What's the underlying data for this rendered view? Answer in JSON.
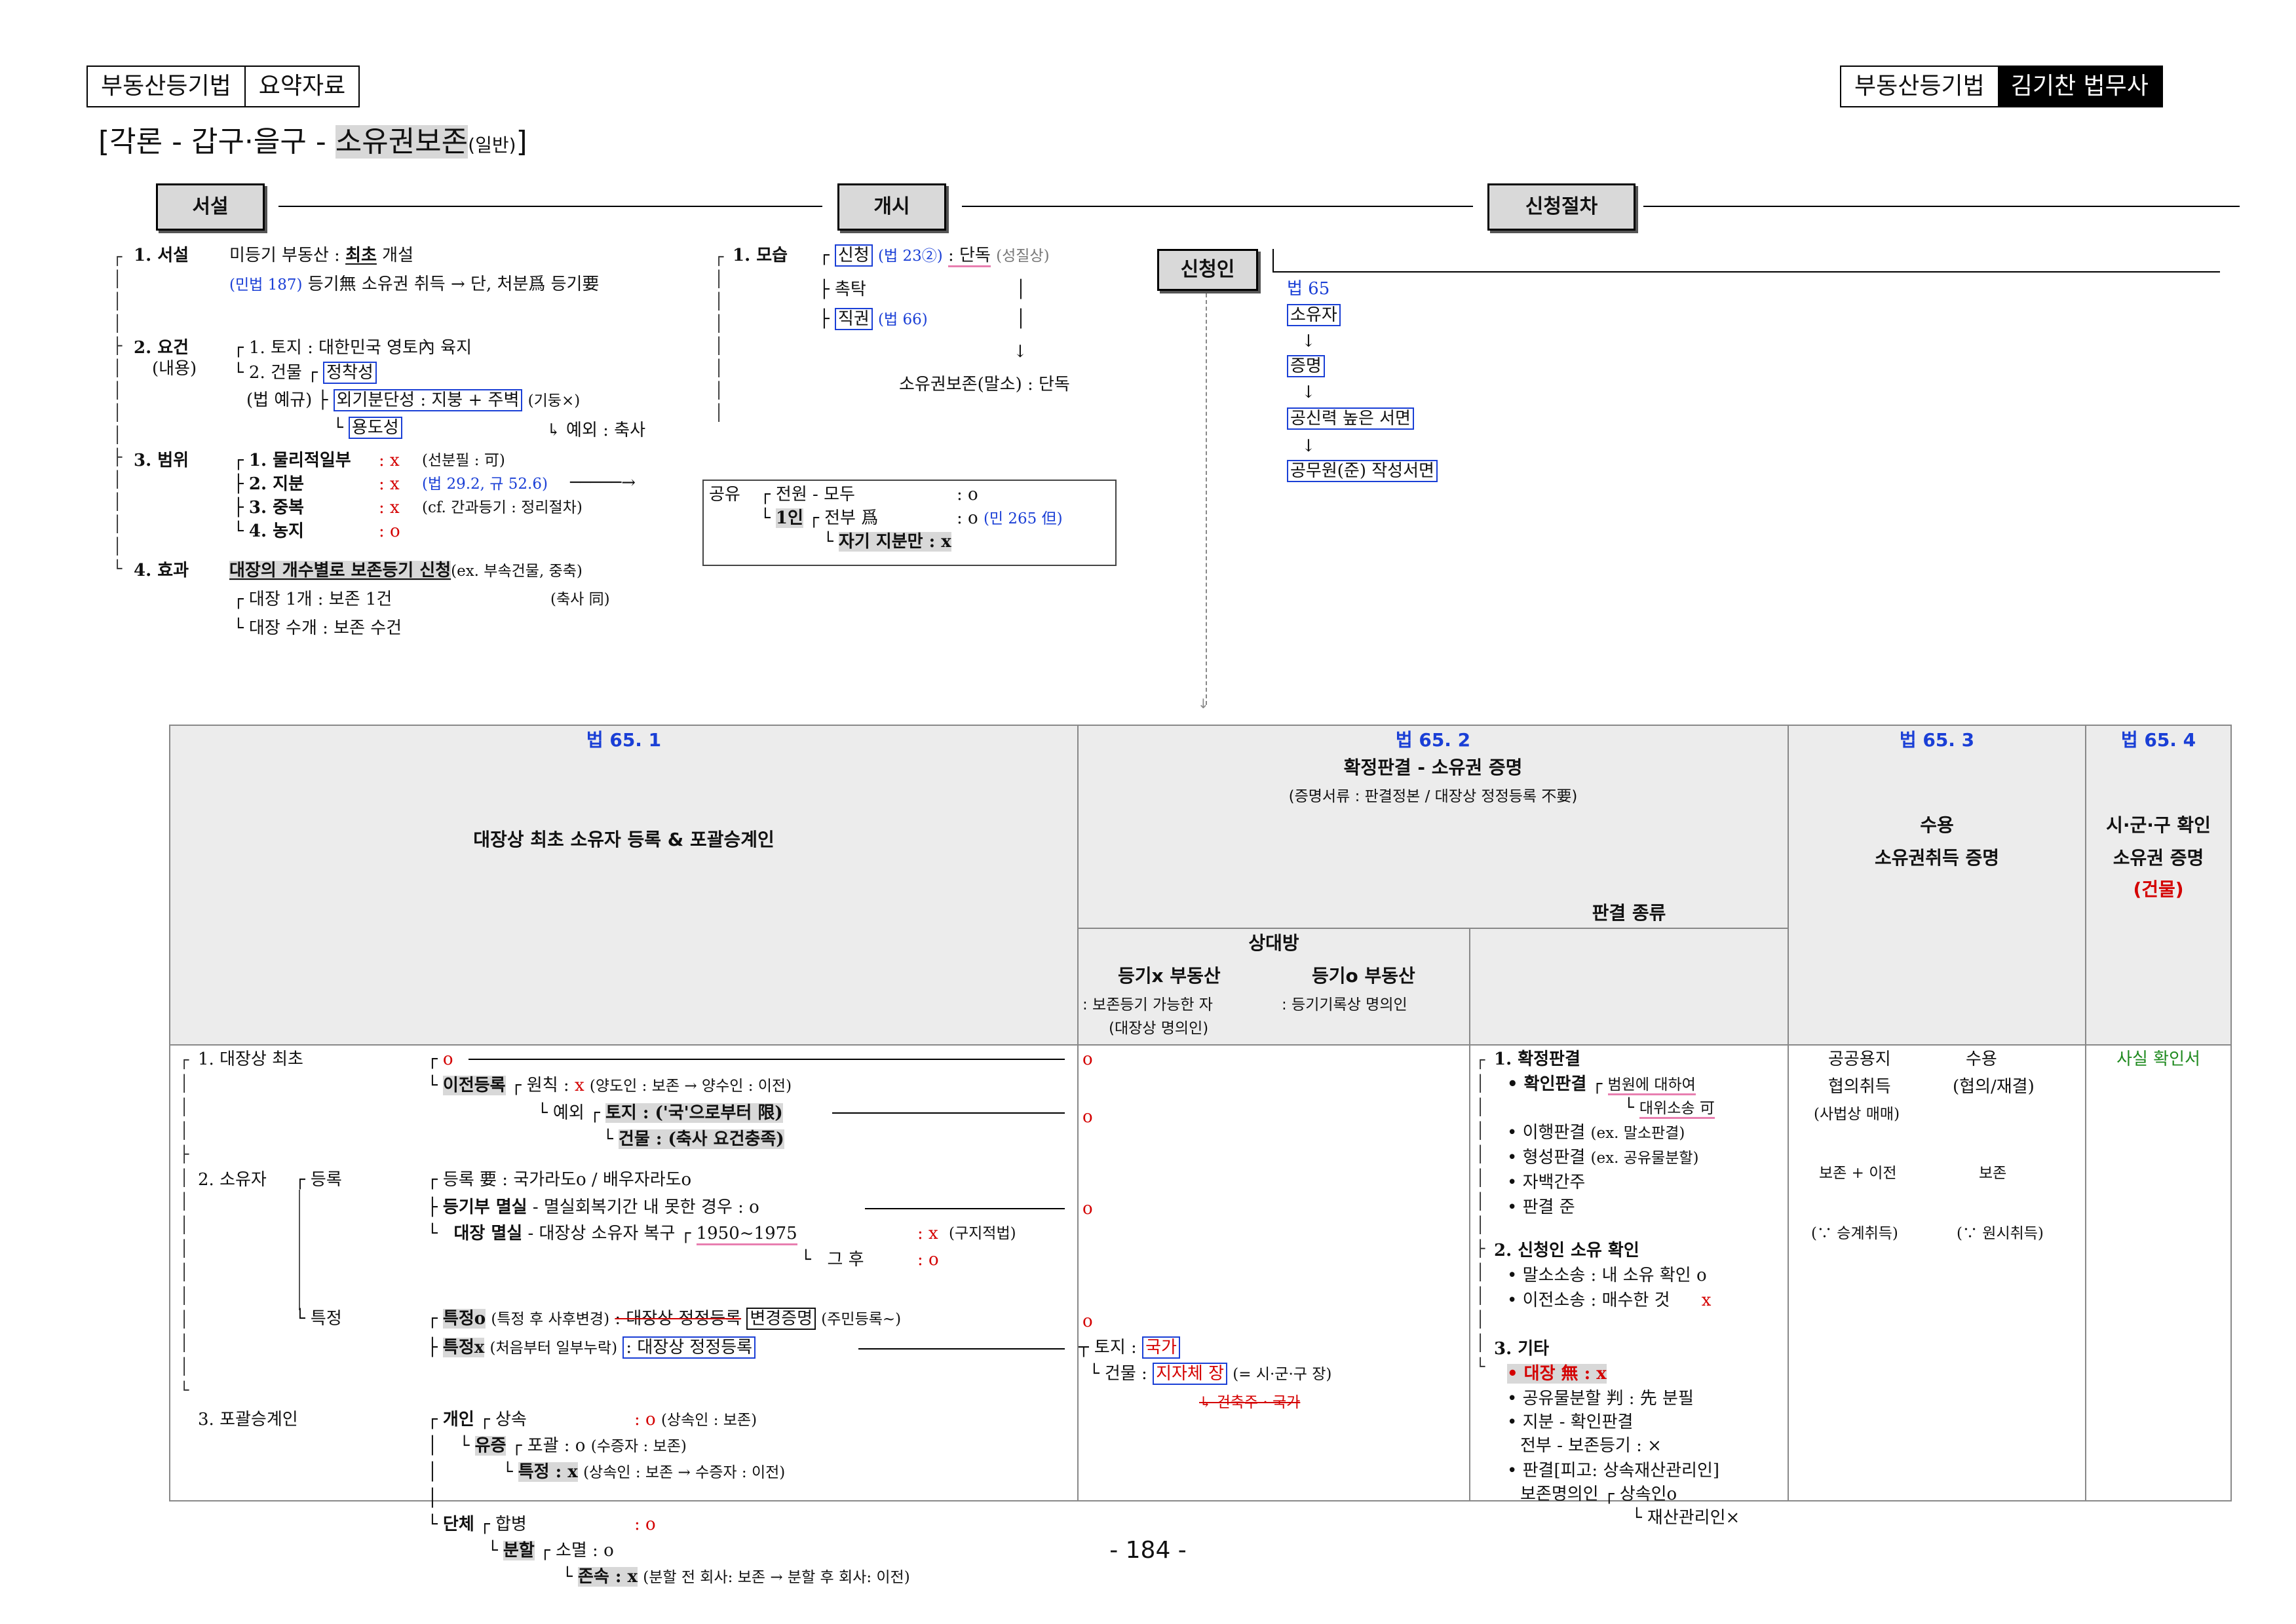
{
  "header": {
    "left_tab1": "부동산등기법",
    "left_tab2": "요약자료",
    "right_tab1": "부동산등기법",
    "right_tab2": "김기찬 법무사"
  },
  "title": {
    "prefix": "[각론 - 갑구·을구 - ",
    "main": "소유권보존",
    "suffix_small": "(일반)",
    "close": "]"
  },
  "sections": {
    "intro": "서설",
    "overview": "개시",
    "procedure": "신청절차"
  },
  "intro": {
    "l1_label": "1. 서설",
    "l1_a": "미등기 부동산 : ",
    "l1_a_b": "최초",
    "l1_a_c": " 개설",
    "l1_b_note": "(민법 187)",
    "l1_b": " 등기無 소유권 취득 → 단, 처분爲 등기要",
    "l2_label": "2. 요건",
    "l2_sub": "(내용)",
    "l2_1": "1. 토지 : 대한민국 영토內 육지",
    "l2_2": "2. 건물",
    "l2_2a": "정착성",
    "l2_2b_prefix": "(법 예규)",
    "l2_2b": "외기분단성 : 지붕 + 주벽",
    "l2_2b_note": "(기둥×)",
    "l2_2c": "용도성",
    "l2_2c_note": "↳ 예외 : 축사",
    "l3_label": "3. 범위",
    "l3_1": "1. 물리적일부",
    "l3_1v": ": x",
    "l3_1n": "(선분필 : 可)",
    "l3_2": "2. 지분",
    "l3_2v": ": x",
    "l3_2n": "(법 29.2, 규 52.6)",
    "l3_3": "3. 중복",
    "l3_3v": ": x",
    "l3_3n": "(cf. 간과등기 : 정리절차)",
    "l3_4": "4. 농지",
    "l3_4v": ": o",
    "l4_label": "4. 효과",
    "l4_a": "대장의 개수별로 보존등기 신청",
    "l4_a_note": "(ex. 부속건물, 중축)",
    "l4_b": "대장 1개 : 보존 1건",
    "l4_b_note": "(축사 同)",
    "l4_c": "대장 수개 : 보존 수건"
  },
  "overview": {
    "label": "1. 모습",
    "a": "신청",
    "a_note": "(법 23②)",
    "a_val": ": 단독",
    "a_val_note": "(성질상)",
    "b": "촉탁",
    "c": "직권",
    "c_note": "(법 66)",
    "result": "소유권보존(말소) : 단독",
    "co_label": "공유",
    "co_1": "전원 - 모두",
    "co_1v": ": o",
    "co_2_lbl": "1인",
    "co_2": "전부 爲",
    "co_2v": ": o",
    "co_2n": "(민 265 但)",
    "co_3": "자기 지분만 : x"
  },
  "procedure": {
    "applicant": "신청인",
    "law": "법 65",
    "p1": "소유자",
    "p2": "증명",
    "p3": "공신력 높은 서면",
    "p4": "공무원(준) 작성서면"
  },
  "table": {
    "c1_law": "법 65. 1",
    "c1_title": "대장상 최초 소유자 등록 & 포괄승계인",
    "c2_law": "법 65. 2",
    "c2_title": "확정판결 - 소유권 증명",
    "c2_note": "(증명서류 : 판결정본 / 대장상 정정등록 不要)",
    "c2a_title": "상대방",
    "c2a_sub1": "등기x 부동산",
    "c2a_sub2": "등기o 부동산",
    "c2a_desc1": ": 보존등기 가능한 자",
    "c2a_desc1b": "(대장상 명의인)",
    "c2a_desc2": ": 등기기록상 명의인",
    "c2b_title": "판결 종류",
    "c3_law": "법 65. 3",
    "c3_title1": "수용",
    "c3_title2": "소유권취득 증명",
    "c4_law": "법 65. 4",
    "c4_title1": "시·군·구 확인",
    "c4_title2": "소유권 증명",
    "c4_title3": "(건물)",
    "r1": "1. 대장상 최초",
    "r1_o": "o",
    "r1_move": "이전등록",
    "r1_rule": "원칙 : ",
    "r1_rule_x": "x",
    "r1_rule_n": "(양도인 : 보존 → 양수인 : 이전)",
    "r1_exc": "예외",
    "r1_exc_a": "토지 : ('국'으로부터 限)",
    "r1_exc_b": "건물 : (축사 요건충족)",
    "r2": "2. 소유자",
    "r2_reg": "등록",
    "r2_a": "등록 要 : 국가라도o / 배우자라도o",
    "r2_b": "등기부 멸실",
    "r2_b2": " - 멸실회복기간 내 못한 경우 : o",
    "r2_c": "대장 멸실",
    "r2_c2": " - 대장상 소유자 복구",
    "r2_c3": "1950~1975",
    "r2_c3v": ": x",
    "r2_c3n": "(구지적법)",
    "r2_c4": "그 후",
    "r2_c4v": ": o",
    "r2_spec": "특정",
    "r2_d": "특정o",
    "r2_d_n": "(특정 후 사후변경)",
    "r2_d2": ": 대장상 정정등록",
    "r2_d3": "변경증명",
    "r2_d4": "(주민등록~)",
    "r2_e": "특정x",
    "r2_e_n": "(처음부터 일부누락)",
    "r2_e2": ": 대장상 정정등록",
    "r3": "3. 포괄승계인",
    "r3_ind": "개인",
    "r3_inh": "상속",
    "r3_inh_v": ": o",
    "r3_inh_n": "(상속인 : 보존)",
    "r3_will": "유증",
    "r3_will_a": "포괄 : o",
    "r3_will_an": "(수증자 : 보존)",
    "r3_will_b": "특정 : x",
    "r3_will_bn": "(상속인 : 보존 → 수증자 : 이전)",
    "r3_grp": "단체",
    "r3_merge": "합병",
    "r3_merge_v": ": o",
    "r3_split": "분할",
    "r3_split_a": "소멸 : o",
    "r3_split_b": "존속 : x",
    "r3_split_bn": "(분할 전 회사: 보존 → 분할 후 회사: 이전)",
    "m_o1": "o",
    "m_o2": "o",
    "m_o3": "o",
    "m_o4": "o",
    "m_land": "토지 : ",
    "m_land_v": "국가",
    "m_bld": "건물 : ",
    "m_bld_v": "지자체 장",
    "m_bld_n": "(= 시·군·구 장)",
    "m_bld_x": "↳ 건축주 · 국가",
    "j1": "1. 확정판결",
    "j1_a": "• 확인판결",
    "j1_a1": "범원에 대하여",
    "j1_a2": "대위소송 可",
    "j1_b": "• 이행판결",
    "j1_b_n": "(ex. 말소판결)",
    "j1_c": "• 형성판결",
    "j1_c_n": "(ex. 공유물분할)",
    "j1_d": "• 자백간주",
    "j1_e": "• 판결 준",
    "j2": "2. 신청인 소유 확인",
    "j2_a": "• 말소소송 : 내 소유 확인 o",
    "j2_b": "• 이전소송 : 매수한 것",
    "j2_bv": "x",
    "j3": "3. 기타",
    "j3_a": "• 대장 無 : x",
    "j3_b": "• 공유물분할 判 : 先 분필",
    "j3_c": "• 지분 - 확인판결",
    "j3_c2": "전부 - 보존등기 : ×",
    "j3_d": "• 판결[피고: 상속재산관리인]",
    "j3_d2": "보존명의인",
    "j3_d3": "상속인o",
    "j3_d4": "재산관리인×",
    "x1a": "공공용지",
    "x1b": "수용",
    "x2a": "협의취득",
    "x2b": "(협의/재결)",
    "x3": "(사법상 매매)",
    "x4a": "보존 + 이전",
    "x4b": "보존",
    "x5a": "(∵ 승계취득)",
    "x5b": "(∵ 원시취득)",
    "y1": "사실 확인서"
  },
  "page_number": "- 184 -"
}
